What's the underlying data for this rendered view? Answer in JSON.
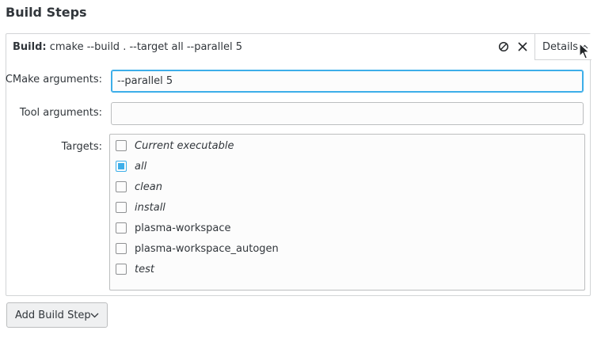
{
  "section_title": "Build Steps",
  "step": {
    "summary_bold": "Build:",
    "summary_text": "cmake --build . --target all --parallel 5",
    "details_label": "Details",
    "icons": {
      "disable": "disable-icon",
      "remove": "close-icon",
      "details_chevron": "chevron-up-icon"
    }
  },
  "fields": {
    "cmake_label": "CMake arguments:",
    "cmake_value": "--parallel 5",
    "tool_label": "Tool arguments:",
    "tool_value": "",
    "targets_label": "Targets:"
  },
  "targets": [
    {
      "label": "Current executable",
      "checked": false,
      "italic": true
    },
    {
      "label": "all",
      "checked": true,
      "italic": true
    },
    {
      "label": "clean",
      "checked": false,
      "italic": true
    },
    {
      "label": "install",
      "checked": false,
      "italic": true
    },
    {
      "label": "plasma-workspace",
      "checked": false,
      "italic": false
    },
    {
      "label": "plasma-workspace_autogen",
      "checked": false,
      "italic": false
    },
    {
      "label": "test",
      "checked": false,
      "italic": true
    }
  ],
  "add_step_label": "Add Build Step",
  "colors": {
    "accent": "#3daee9",
    "text": "#31363b",
    "border": "#bcbebf"
  }
}
